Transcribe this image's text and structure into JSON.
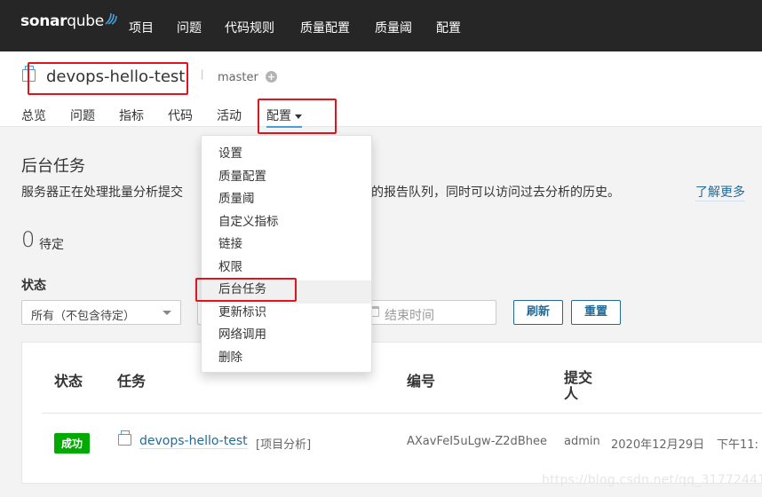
{
  "topnav": {
    "logo_a": "sonar",
    "logo_b": "qube",
    "items": [
      "项目",
      "问题",
      "代码规则",
      "质量配置",
      "质量阈",
      "配置"
    ]
  },
  "project": {
    "name": "devops-hello-test",
    "branch": "master",
    "tabs": [
      "总览",
      "问题",
      "指标",
      "代码",
      "活动",
      "配置"
    ]
  },
  "page": {
    "title": "后台任务",
    "description": "服务器正在处理批量分析提交",
    "description_tail": "待执行的报告队列，同时可以访问过去分析的历史。",
    "learn_more": "了解更多",
    "pending_count": "0",
    "pending_label": "待定",
    "status_label": "状态",
    "status_select": "所有（不包含待定）",
    "end_time_placeholder": "结束时间",
    "refresh_button": "刷新",
    "reset_button": "重置"
  },
  "table": {
    "headers": [
      "状态",
      "任务",
      "编号",
      "提交人"
    ],
    "row": {
      "status": "成功",
      "task": "devops-hello-test",
      "task_type": "[项目分析]",
      "id": "AXavFeI5uLgw-Z2dBhee",
      "submitter": "admin",
      "date": "2020年12月29日",
      "time": "下午11:"
    }
  },
  "dropdown": {
    "items": [
      "设置",
      "质量配置",
      "质量阈",
      "自定义指标",
      "链接",
      "权限",
      "后台任务",
      "更新标识",
      "网络调用",
      "删除"
    ]
  },
  "colors": {
    "topnav_bg": "#262626",
    "accent": "#4b9fd5",
    "link": "#236a97",
    "success": "#00aa00",
    "annotation": "#e0141e"
  },
  "watermark": "https://blog.csdn.net/qq_31772441"
}
